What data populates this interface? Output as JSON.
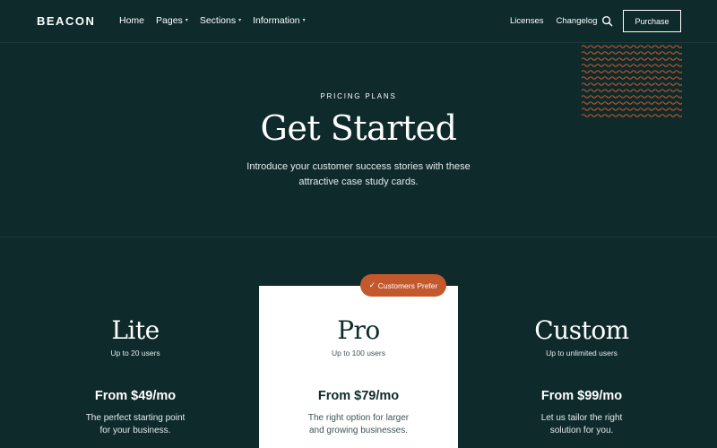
{
  "nav": {
    "logo": "BEACON",
    "menu": [
      {
        "label": "Home",
        "has_dropdown": false
      },
      {
        "label": "Pages",
        "has_dropdown": true
      },
      {
        "label": "Sections",
        "has_dropdown": true
      },
      {
        "label": "Information",
        "has_dropdown": true
      }
    ],
    "right_links": [
      "Licenses",
      "Changelog"
    ],
    "search_icon": "search-icon",
    "purchase_label": "Purchase"
  },
  "hero": {
    "eyebrow": "PRICING PLANS",
    "title": "Get Started",
    "text_line1": "Introduce your customer success stories with these",
    "text_line2": "attractive case study cards."
  },
  "badge": {
    "label": "Customers Prefer",
    "icon": "check-icon"
  },
  "plans": [
    {
      "name": "Lite",
      "users": "Up to 20 users",
      "price": "From $49/mo",
      "desc_line1": "The perfect starting point",
      "desc_line2": "for your business."
    },
    {
      "name": "Pro",
      "users": "Up to 100 users",
      "price": "From $79/mo",
      "desc_line1": "The right option for larger",
      "desc_line2": "and growing businesses."
    },
    {
      "name": "Custom",
      "users": "Up to unlimited users",
      "price": "From $99/mo",
      "desc_line1": "Let us tailor the right",
      "desc_line2": "solution for you."
    }
  ],
  "colors": {
    "background": "#0e2a2b",
    "accent": "#c4582d",
    "card_highlight": "#ffffff"
  }
}
